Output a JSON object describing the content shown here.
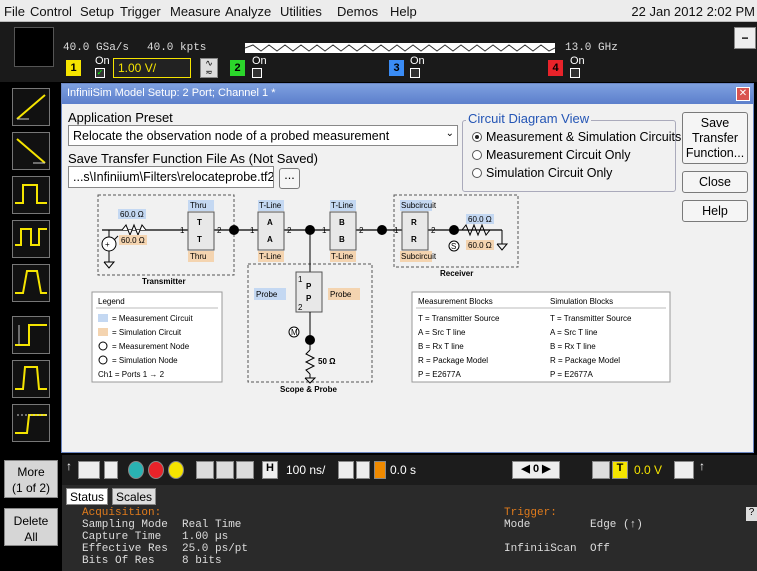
{
  "menubar": {
    "items": [
      "File",
      "Control",
      "Setup",
      "Trigger",
      "Measure",
      "Analyze",
      "Utilities",
      "Demos",
      "Help"
    ],
    "datetime": "22 Jan 2012 2:02 PM"
  },
  "top": {
    "sample_rate": "40.0 GSa/s",
    "memory": "40.0 kpts",
    "bandwidth": "13.0 GHz",
    "ch1_scale": "1.00 V/",
    "on_label": "On",
    "ch_numbers": [
      "1",
      "2",
      "3",
      "4"
    ]
  },
  "dialog": {
    "title": "InfiniiSim Model Setup: 2 Port; Channel 1 *",
    "preset_label": "Application Preset",
    "preset_value": "Relocate the observation node of a probed measurement",
    "save_label": "Save Transfer Function File As (Not Saved)",
    "save_path": "...s\\Infiniium\\Filters\\relocateprobe.tf2",
    "browse_label": "...",
    "circuit_view_label": "Circuit Diagram View",
    "radio_options": [
      "Measurement & Simulation Circuits",
      "Measurement Circuit Only",
      "Simulation Circuit Only"
    ],
    "selected_radio": 0,
    "save_tf_button": "Save Transfer Function...",
    "close_button": "Close",
    "help_button": "Help"
  },
  "diagram": {
    "resistor_values": [
      "60.0 Ω",
      "60.0 Ω",
      "60.0 Ω",
      "60.0 Ω",
      "50 Ω"
    ],
    "block_labels_top": [
      "Thru",
      "T-Line",
      "T-Line",
      "Subcircuit"
    ],
    "block_labels_bottom": [
      "Thru",
      "T-Line",
      "T-Line",
      "Subcircuit"
    ],
    "probe_label": "Probe",
    "group_labels": [
      "Transmitter",
      "Receiver",
      "Scope & Probe"
    ],
    "legend_title": "Legend",
    "legend_items": [
      "= Measurement Circuit",
      "= Simulation Circuit",
      "= Measurement Node",
      "= Simulation Node",
      "Ch1 = Ports 1 → 2"
    ],
    "meas_blocks_title": "Measurement Blocks",
    "sim_blocks_title": "Simulation Blocks",
    "meas_blocks": [
      "T = Transmitter Source",
      "A = Src T line",
      "B = Rx T line",
      "R = Package Model",
      "P = E2677A"
    ],
    "sim_blocks": [
      "T = Transmitter Source",
      "A = Src T line",
      "B = Rx T line",
      "R = Package Model",
      "P = E2677A"
    ]
  },
  "sidebar": {
    "more_label": "More\n(1 of 2)",
    "delete_label": "Delete All"
  },
  "controls": {
    "timebase": "100 ns/",
    "delay": "0.0 s",
    "nav_value": "0",
    "trigger_level": "0.0 V",
    "trigger_channel": "T"
  },
  "status": {
    "tabs": [
      "Status",
      "Scales"
    ],
    "acq_header": "Acquisition:",
    "rows": [
      {
        "k": "Sampling Mode",
        "v": "Real Time"
      },
      {
        "k": "Capture Time",
        "v": "1.00 µs"
      },
      {
        "k": "Effective Res",
        "v": "25.0 ps/pt"
      },
      {
        "k": "Bits Of Res",
        "v": "8 bits"
      }
    ],
    "trigger_header": "Trigger:",
    "trigger_rows": [
      {
        "k": "Mode",
        "v": "Edge (↑)"
      },
      {
        "k": "InfiniiScan",
        "v": "Off"
      }
    ]
  },
  "colors": {
    "ch1": "#f5e400",
    "ch2": "#2bd62b",
    "ch3": "#3a8cf5",
    "ch4": "#e8232a",
    "dialog_title": "#5c7fcc",
    "meas_circuit": "#c4d8f2",
    "sim_circuit": "#f4d4b0"
  }
}
